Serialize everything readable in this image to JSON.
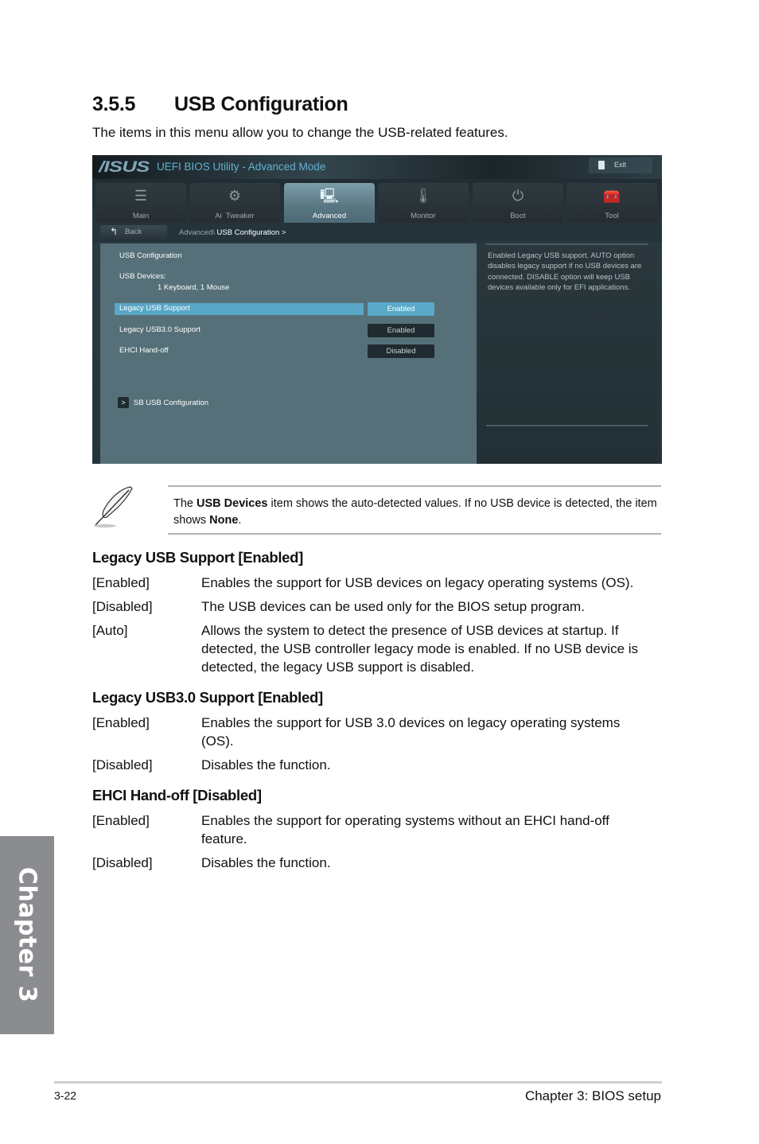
{
  "section": {
    "number": "3.5.5",
    "title": "USB Configuration",
    "intro": "The items in this menu allow you to change the USB-related features."
  },
  "bios": {
    "brand": "/ISUS",
    "title": "UEFI BIOS Utility - Advanced Mode",
    "exit_label": "Exit",
    "tabs": [
      {
        "label": "Main",
        "icon": "list-icon",
        "glyph": "☰",
        "active": false
      },
      {
        "label": "Ai  Tweaker",
        "icon": "tweaker-icon",
        "glyph": "⚙",
        "active": false
      },
      {
        "label": "Advanced",
        "icon": "advanced-info-icon",
        "glyph": "🖳",
        "active": true
      },
      {
        "label": "Monitor",
        "icon": "thermometer-icon",
        "glyph": "🌡",
        "active": false
      },
      {
        "label": "Boot",
        "icon": "power-icon",
        "glyph": "⏻",
        "active": false
      },
      {
        "label": "Tool",
        "icon": "toolbox-icon",
        "glyph": "🧰",
        "active": false
      }
    ],
    "back_label": "Back",
    "breadcrumb": {
      "parent": "Advanced\\",
      "current": "USB Configuration",
      "separator": ">"
    },
    "panel": {
      "heading": "USB Configuration",
      "usb_devices_label": "USB Devices:",
      "usb_devices_value": "1 Keyboard, 1 Mouse",
      "settings": [
        {
          "label": "Legacy USB Support",
          "value": "Enabled",
          "selected": true
        },
        {
          "label": "Legacy USB3.0 Support",
          "value": "Enabled",
          "selected": false
        },
        {
          "label": "EHCI Hand-off",
          "value": "Disabled",
          "selected": false
        }
      ],
      "submenu_arrow": ">",
      "submenu_label": "SB USB Configuration"
    },
    "help_text": "Enabled Legacy USB support. AUTO option disables legacy support if no USB devices are connected. DISABLE option will keep USB devices available only for EFI applications."
  },
  "note": {
    "prefix": "The ",
    "bold1": "USB Devices",
    "middle": " item shows the auto-detected values. If no USB device is detected, the item shows ",
    "bold2": "None",
    "suffix": "."
  },
  "items": [
    {
      "title": "Legacy USB Support [Enabled]",
      "options": [
        {
          "name": "[Enabled]",
          "desc": "Enables the support for USB devices on legacy operating systems (OS)."
        },
        {
          "name": "[Disabled]",
          "desc": "The USB devices can be used only for the BIOS setup program."
        },
        {
          "name": "[Auto]",
          "desc": "Allows the system to detect the presence of USB devices at startup. If detected, the USB controller legacy mode is enabled. If no USB device is detected, the legacy USB support is disabled."
        }
      ]
    },
    {
      "title": "Legacy USB3.0 Support [Enabled]",
      "options": [
        {
          "name": "[Enabled]",
          "desc": "Enables the support for USB 3.0 devices on legacy operating systems (OS)."
        },
        {
          "name": "[Disabled]",
          "desc": "Disables the function."
        }
      ]
    },
    {
      "title": "EHCI Hand-off [Disabled]",
      "options": [
        {
          "name": "[Enabled]",
          "desc": "Enables the support for operating systems without an EHCI hand-off feature."
        },
        {
          "name": "[Disabled]",
          "desc": "Disables the function."
        }
      ]
    }
  ],
  "chapter_tab": "Chapter 3",
  "footer": {
    "page_number": "3-22",
    "chapter_title": "Chapter 3: BIOS setup"
  },
  "colors": {
    "bios_accent": "#5aa9c8",
    "bios_panel": "#557078",
    "chapter_tab": "#8b8c8f"
  }
}
